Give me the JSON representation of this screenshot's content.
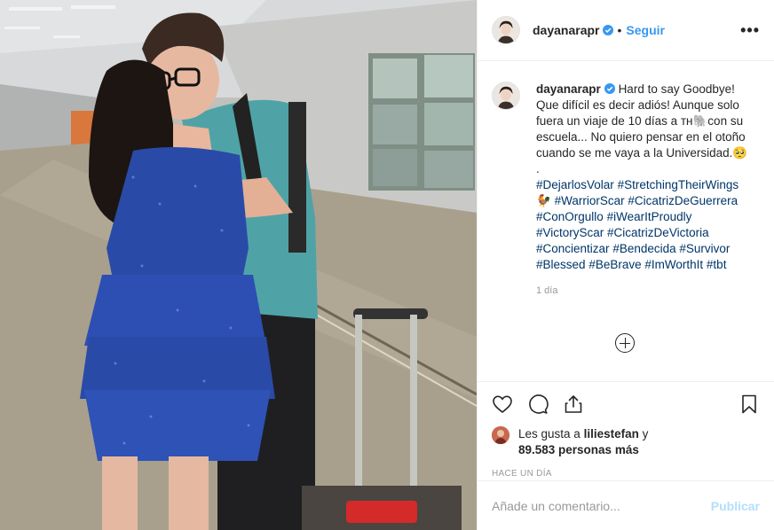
{
  "post": {
    "username": "dayanarapr",
    "separator": "•",
    "follow_label": "Seguir",
    "more_label": "•••",
    "caption": {
      "username": "dayanarapr",
      "text": "Hard to say Goodbye! Que difícil es decir adiós! Aunque solo fuera un viaje de 10 días a ᴛʜ🐘con su escuela... No quiero pensar en el otoño cuando se me vaya a la Universidad.🥺",
      "period": ".",
      "tags_lines": [
        [
          "#DejarlosVolar",
          "#StretchingTheirWings"
        ],
        [
          "🐓",
          "#WarriorScar",
          "#CicatrizDeGuerrera"
        ],
        [
          "#ConOrgullo",
          "#iWearItProudly"
        ],
        [
          "#VictoryScar",
          "#CicatrizDeVictoria"
        ],
        [
          "#Concientizar",
          "#Bendecida",
          "#Survivor"
        ],
        [
          "#Blessed",
          "#BeBrave",
          "#ImWorthIt",
          "#tbt"
        ]
      ]
    },
    "caption_time": "1 día",
    "likes": {
      "prefix": "Les gusta a",
      "user": "liliestefan",
      "joiner": "y",
      "count": "89.583 personas más"
    },
    "date": "HACE UN DÍA",
    "comment_placeholder": "Añade un comentario...",
    "publish_label": "Publicar"
  },
  "icons": {
    "verified": "verified-badge-icon",
    "heart": "heart-icon",
    "comment": "comment-icon",
    "share": "share-icon",
    "save": "bookmark-icon",
    "load_more": "plus-circle-icon"
  },
  "colors": {
    "link_blue": "#3897f0",
    "hashtag": "#003569",
    "muted": "#999999",
    "publish_disabled": "#b2dffc",
    "dress": "#2a4aa8"
  }
}
